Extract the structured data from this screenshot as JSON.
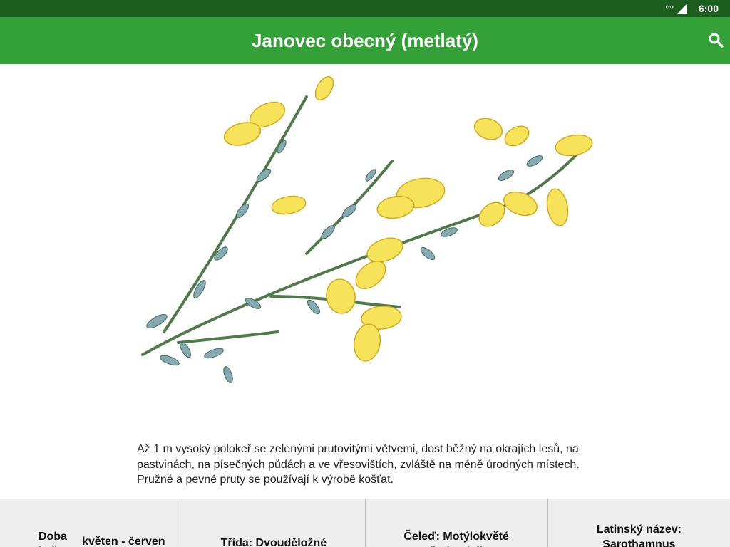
{
  "status_bar": {
    "time": "6:00",
    "network": "LTE"
  },
  "app_bar": {
    "title": "Janovec obecný (metlatý)"
  },
  "description": "Až 1 m vysoký polokeř se zelenými prutovitými větvemi, dost běžný na okrajích lesů, na pastvinách, na písečných půdách a ve vřesovištích, zvláště na méně úrodných místech. Pružné a pevné pruty se používají k výrobě košťat.",
  "info": {
    "bloom_label": "Doba květu:",
    "bloom_value": "květen - červen",
    "class": "Třída: Dvouděložné",
    "family": "Čeleď: Motýlokvěté (bobovité)",
    "latin": "Latinský název: Sarothamnus scoparius"
  },
  "icons": {
    "search": "search-icon",
    "signal": "signal-icon",
    "data": "data-transfer-icon"
  },
  "colors": {
    "status_bar": "#1b5e20",
    "app_bar": "#34a038",
    "info_bar": "#eeeeee"
  }
}
